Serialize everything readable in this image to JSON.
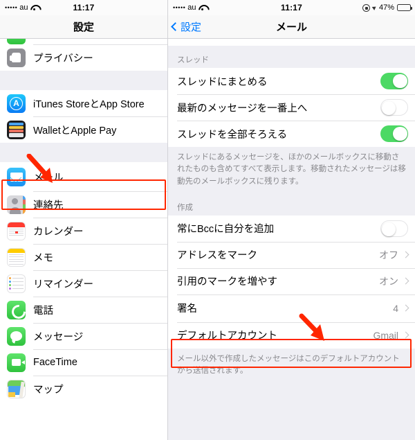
{
  "left_panel": {
    "statusbar": {
      "signal_dots": "•••••",
      "carrier": "au",
      "wifi_icon": "wifi-icon",
      "time": "11:17"
    },
    "navbar": {
      "title": "設定"
    },
    "items": [
      {
        "label": "プライバシー",
        "icon": "privacy-hand-icon",
        "group_end": true
      },
      {
        "label": "iTunes StoreとApp Store",
        "icon": "app-store-icon"
      },
      {
        "label": "WalletとApple Pay",
        "icon": "wallet-icon",
        "group_end": true
      },
      {
        "label": "メール",
        "icon": "mail-icon",
        "highlighted": true,
        "group_end": false
      },
      {
        "label": "連絡先",
        "icon": "contacts-icon"
      },
      {
        "label": "カレンダー",
        "icon": "calendar-icon"
      },
      {
        "label": "メモ",
        "icon": "notes-icon"
      },
      {
        "label": "リマインダー",
        "icon": "reminders-icon"
      },
      {
        "label": "電話",
        "icon": "phone-icon"
      },
      {
        "label": "メッセージ",
        "icon": "messages-icon"
      },
      {
        "label": "FaceTime",
        "icon": "facetime-icon"
      },
      {
        "label": "マップ",
        "icon": "maps-icon"
      }
    ]
  },
  "right_panel": {
    "statusbar": {
      "signal_dots": "•••••",
      "carrier": "au",
      "wifi_icon": "wifi-icon",
      "time": "11:17",
      "rotation_lock_icon": "rotation-lock-icon",
      "location_icon": "location-arrow-icon",
      "battery_percent": "47%",
      "battery_level": 47
    },
    "navbar": {
      "back_label": "設定",
      "title": "メール"
    },
    "sections": [
      {
        "header": "スレッド",
        "rows": [
          {
            "label": "スレッドにまとめる",
            "control": "toggle",
            "value": "on"
          },
          {
            "label": "最新のメッセージを一番上へ",
            "control": "toggle",
            "value": "off"
          },
          {
            "label": "スレッドを全部そろえる",
            "control": "toggle",
            "value": "on"
          }
        ],
        "footer": "スレッドにあるメッセージを、ほかのメールボックスに移動されたものも含めてすべて表示します。移動されたメッセージは移動先のメールボックスに残ります。"
      },
      {
        "header": "作成",
        "rows": [
          {
            "label": "常にBccに自分を追加",
            "control": "toggle",
            "value": "off"
          },
          {
            "label": "アドレスをマーク",
            "control": "disclosure",
            "value": "オフ"
          },
          {
            "label": "引用のマークを増やす",
            "control": "disclosure",
            "value": "オン"
          },
          {
            "label": "署名",
            "control": "disclosure",
            "value": "4",
            "highlighted": true
          },
          {
            "label": "デフォルトアカウント",
            "control": "disclosure",
            "value": "Gmail"
          }
        ],
        "footer": "メール以外で作成したメッセージはこのデフォルトアカウントから送信されます。"
      }
    ]
  },
  "annotations": {
    "color": "#ff2600",
    "mail_box": "highlight-box-mail-row",
    "mail_arrow": "arrow-pointing-to-mail-row",
    "signature_box": "highlight-box-signature-row",
    "signature_arrow": "arrow-pointing-to-signature-row"
  }
}
